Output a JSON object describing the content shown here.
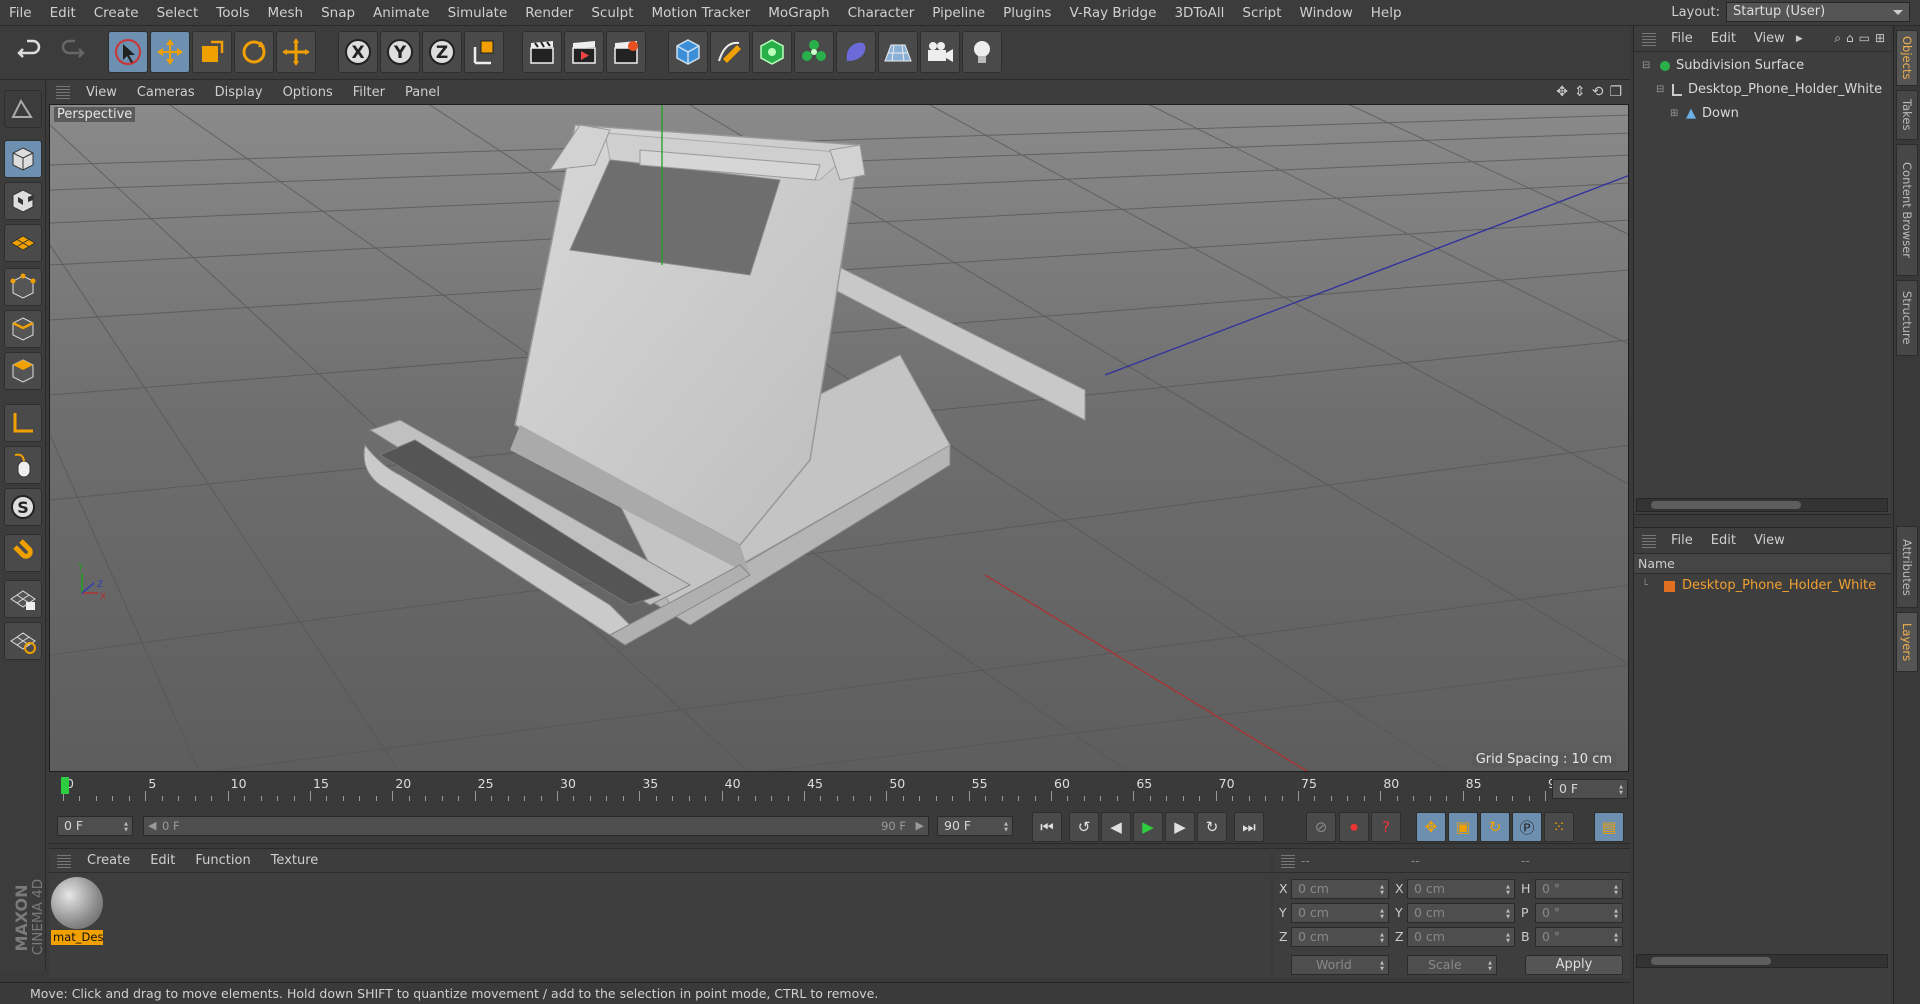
{
  "menubar": {
    "items": [
      "File",
      "Edit",
      "Create",
      "Select",
      "Tools",
      "Mesh",
      "Snap",
      "Animate",
      "Simulate",
      "Render",
      "Sculpt",
      "Motion Tracker",
      "MoGraph",
      "Character",
      "Pipeline",
      "Plugins",
      "V-Ray Bridge",
      "3DToAll",
      "Script",
      "Window",
      "Help"
    ],
    "layout_label": "Layout:",
    "layout_value": "Startup (User)"
  },
  "viewport": {
    "menu": [
      "View",
      "Cameras",
      "Display",
      "Options",
      "Filter",
      "Panel"
    ],
    "label": "Perspective",
    "grid_info": "Grid Spacing : 10 cm",
    "axis_labels": [
      "Y",
      "Z",
      "X"
    ]
  },
  "timeline": {
    "ticks": [
      "0",
      "5",
      "10",
      "15",
      "20",
      "25",
      "30",
      "35",
      "40",
      "45",
      "50",
      "55",
      "60",
      "65",
      "70",
      "75",
      "80",
      "85",
      "90"
    ],
    "current_frame": "0 F"
  },
  "playback": {
    "start_frame": "0 F",
    "range_start": "0 F",
    "range_end": "90 F",
    "end_frame": "90 F"
  },
  "material_panel": {
    "menu": [
      "Create",
      "Edit",
      "Function",
      "Texture"
    ],
    "material_name": "mat_Des"
  },
  "attributes": {
    "header": [
      "--",
      "--",
      "--"
    ],
    "rows": [
      {
        "l1": "X",
        "v1": "0 cm",
        "l2": "X",
        "v2": "0 cm",
        "l3": "H",
        "v3": "0 °"
      },
      {
        "l1": "Y",
        "v1": "0 cm",
        "l2": "Y",
        "v2": "0 cm",
        "l3": "P",
        "v3": "0 °"
      },
      {
        "l1": "Z",
        "v1": "0 cm",
        "l2": "Z",
        "v2": "0 cm",
        "l3": "B",
        "v3": "0 °"
      }
    ],
    "coord_system": "World",
    "mode": "Scale",
    "apply_label": "Apply"
  },
  "objects_panel": {
    "menu": [
      "File",
      "Edit",
      "View"
    ],
    "items": [
      "Subdivision Surface",
      "Desktop_Phone_Holder_White",
      "Down"
    ]
  },
  "layers_panel": {
    "menu": [
      "File",
      "Edit",
      "View"
    ],
    "column": "Name",
    "items": [
      "Desktop_Phone_Holder_White"
    ],
    "layer_color": "#e07020"
  },
  "side_tabs": [
    "Objects",
    "Takes",
    "Content Browser",
    "Structure",
    "Attributes",
    "Layers"
  ],
  "status": "Move: Click and drag to move elements. Hold down SHIFT to quantize movement / add to the selection in point mode, CTRL to remove.",
  "brand": {
    "line1": "MAXON",
    "line2": "CINEMA 4D"
  },
  "colors": {
    "accent": "#6d8fb0",
    "selection": "#f0a030"
  }
}
